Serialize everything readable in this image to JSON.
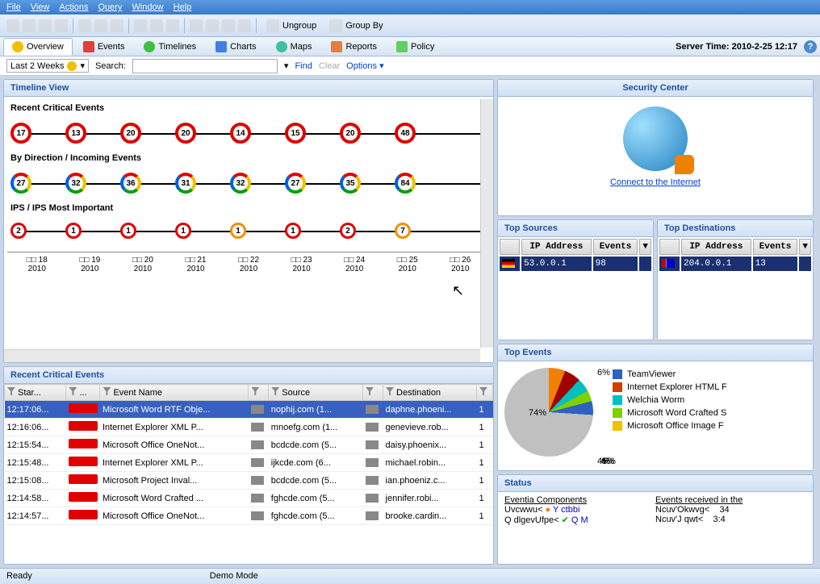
{
  "menu": [
    "File",
    "View",
    "Actions",
    "Query",
    "Window",
    "Help"
  ],
  "toolbar": {
    "ungroup": "Ungroup",
    "groupby": "Group By"
  },
  "tabs": [
    {
      "label": "Overview"
    },
    {
      "label": "Events"
    },
    {
      "label": "Timelines"
    },
    {
      "label": "Charts"
    },
    {
      "label": "Maps"
    },
    {
      "label": "Reports"
    },
    {
      "label": "Policy"
    }
  ],
  "server_time_label": "Server Time:",
  "server_time": "2010-2-25 12:17",
  "filter": {
    "range": "Last 2 Weeks",
    "search_label": "Search:",
    "find": "Find",
    "clear": "Clear",
    "options": "Options"
  },
  "timeline": {
    "title": "Timeline View",
    "s1": "Recent Critical Events",
    "s2": "By Direction / Incoming Events",
    "s3": "IPS / IPS Most Important",
    "row1": [
      "17",
      "13",
      "20",
      "20",
      "14",
      "15",
      "20",
      "48"
    ],
    "row2": [
      "27",
      "32",
      "36",
      "31",
      "32",
      "27",
      "35",
      "84"
    ],
    "row3": [
      "2",
      "1",
      "1",
      "1",
      "1",
      "1",
      "2",
      "7"
    ],
    "axis": [
      {
        "d": "□□ 18",
        "y": "2010"
      },
      {
        "d": "□□ 19",
        "y": "2010"
      },
      {
        "d": "□□ 20",
        "y": "2010"
      },
      {
        "d": "□□ 21",
        "y": "2010"
      },
      {
        "d": "□□ 22",
        "y": "2010"
      },
      {
        "d": "□□ 23",
        "y": "2010"
      },
      {
        "d": "□□ 24",
        "y": "2010"
      },
      {
        "d": "□□ 25",
        "y": "2010"
      },
      {
        "d": "□□ 26",
        "y": "2010"
      }
    ]
  },
  "events": {
    "title": "Recent Critical Events",
    "cols": [
      "Star...",
      "...",
      "Event Name",
      "",
      "Source",
      "",
      "Destination",
      ""
    ],
    "rows": [
      {
        "t": "12:17:06...",
        "n": "Microsoft Word RTF Obje...",
        "s": "nophij.com (1...",
        "d": "daphne.phoeni...",
        "c": "1"
      },
      {
        "t": "12:16:06...",
        "n": "Internet Explorer XML P...",
        "s": "mnoefg.com (1...",
        "d": "genevieve.rob...",
        "c": "1"
      },
      {
        "t": "12:15:54...",
        "n": "Microsoft Office OneNot...",
        "s": "bcdcde.com (5...",
        "d": "daisy.phoenix...",
        "c": "1"
      },
      {
        "t": "12:15:48...",
        "n": "Internet Explorer XML P...",
        "s": "ijkcde.com (6...",
        "d": "michael.robin...",
        "c": "1"
      },
      {
        "t": "12:15:08...",
        "n": "Microsoft Project Inval...",
        "s": "bcdcde.com (5...",
        "d": "ian.phoeniz.c...",
        "c": "1"
      },
      {
        "t": "12:14:58...",
        "n": "Microsoft Word Crafted ...",
        "s": "fghcde.com (5...",
        "d": "jennifer.robi...",
        "c": "1"
      },
      {
        "t": "12:14:57...",
        "n": "Microsoft Office OneNot...",
        "s": "fghcde.com (5...",
        "d": "brooke.cardin...",
        "c": "1"
      }
    ]
  },
  "sec_center": {
    "title": "Security Center",
    "link": "Connect to the Internet"
  },
  "top_sources": {
    "title": "Top Sources",
    "cols": [
      "IP Address",
      "Events"
    ],
    "row": [
      "53.0.0.1",
      "98"
    ]
  },
  "top_dest": {
    "title": "Top Destinations",
    "cols": [
      "IP Address",
      "Events"
    ],
    "row": [
      "204.0.0.1",
      "13"
    ]
  },
  "top_events": {
    "title": "Top Events",
    "pct": "74%",
    "slices": [
      "6%",
      "6%",
      "5%",
      "4%",
      "4%"
    ],
    "legend": [
      {
        "c": "#3060c0",
        "l": "TeamViewer"
      },
      {
        "c": "#d04000",
        "l": "Internet Explorer HTML F"
      },
      {
        "c": "#00c0c0",
        "l": "Welchia Worm"
      },
      {
        "c": "#80d000",
        "l": "Microsoft Word Crafted S"
      },
      {
        "c": "#f0c000",
        "l": "Microsoft Office Image F"
      }
    ]
  },
  "chart_data": {
    "type": "pie",
    "title": "Top Events",
    "series": [
      {
        "name": "TeamViewer",
        "value": 6
      },
      {
        "name": "Internet Explorer HTML F",
        "value": 6
      },
      {
        "name": "Welchia Worm",
        "value": 5
      },
      {
        "name": "Microsoft Word Crafted S",
        "value": 4
      },
      {
        "name": "Microsoft Office Image F",
        "value": 4
      },
      {
        "name": "Other",
        "value": 74
      }
    ]
  },
  "status": {
    "title": "Status",
    "comp_hdr": "Eventia Components",
    "comp": [
      [
        "Uvcwwu<",
        "Y ctbbi"
      ],
      [
        "Q dlgevUfpe<",
        "Q M"
      ]
    ],
    "recv_hdr": "Events received in the",
    "recv": [
      [
        "Ncuv'Okwvg<",
        "34"
      ],
      [
        "Ncuv'J qwt<",
        "3:4"
      ]
    ]
  },
  "statusbar": {
    "ready": "Ready",
    "mode": "Demo Mode"
  }
}
